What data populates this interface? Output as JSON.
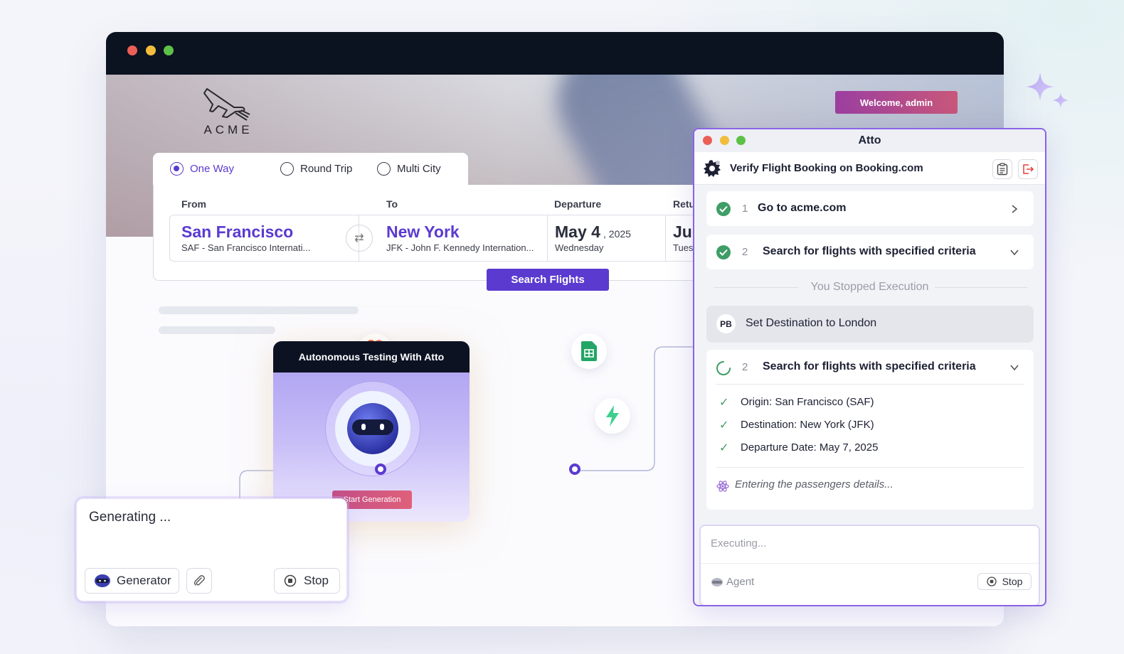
{
  "browser": {
    "logo_text": "ACME",
    "welcome_button": "Welcome, admin"
  },
  "booking": {
    "trip_types": [
      "One Way",
      "Round Trip",
      "Multi City"
    ],
    "selected_trip_type": "One Way",
    "labels": {
      "from": "From",
      "to": "To",
      "departure": "Departure",
      "return": "Retu"
    },
    "from": {
      "city": "San Francisco",
      "airport": "SAF - San Francisco Internati..."
    },
    "to": {
      "city": "New York",
      "airport": "JFK - John F. Kennedy Internation..."
    },
    "departure": {
      "day": "May 4",
      "year": ", 2025",
      "weekday": "Wednesday"
    },
    "return": {
      "day": "Jur",
      "weekday": "Tues"
    },
    "search_button": "Search Flights"
  },
  "flow": {
    "card_title": "Autonomous Testing With Atto",
    "start_button": "Start Generation",
    "integration_icons": [
      "figma-icon",
      "google-sheets-icon",
      "jira-icon",
      "bolt-icon"
    ]
  },
  "generator": {
    "status": "Generating ...",
    "generator_button": "Generator",
    "stop_button": "Stop"
  },
  "atto": {
    "title": "Atto",
    "task": "Verify Flight Booking on Booking.com",
    "steps": [
      {
        "num": "1",
        "text": "Go to acme.com",
        "status": "done"
      },
      {
        "num": "2",
        "text": "Search for flights with specified criteria",
        "status": "done"
      }
    ],
    "stopped_text": "You Stopped Execution",
    "user_initials": "PB",
    "user_request": "Set Destination to London",
    "active_step": {
      "num": "2",
      "text": "Search for flights with specified criteria",
      "criteria": [
        "Origin: San Francisco (SAF)",
        "Destination: New York (JFK)",
        "Departure Date: May 7, 2025"
      ],
      "progress_text": "Entering the passengers details..."
    },
    "input_placeholder": "Executing...",
    "agent_label": "Agent",
    "stop_button": "Stop"
  },
  "colors": {
    "accent": "#5b3ad0",
    "success": "#3f9d66",
    "welcome_gradient": [
      "#9b3fa0",
      "#c8577a"
    ]
  }
}
